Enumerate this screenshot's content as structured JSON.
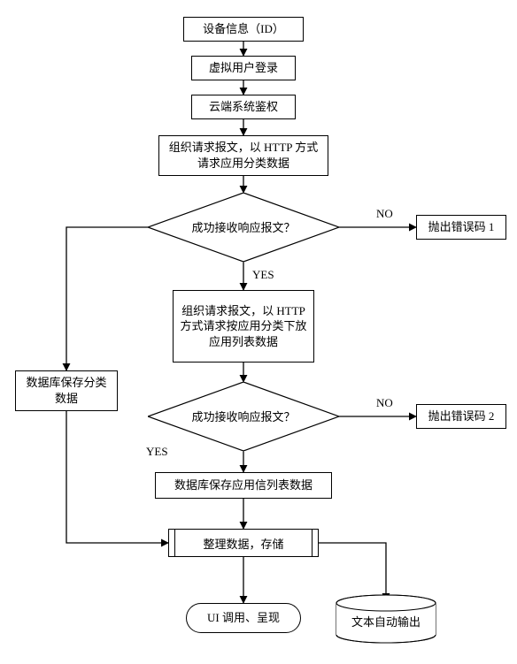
{
  "chart_data": {
    "type": "flowchart",
    "nodes": [
      {
        "id": "n1",
        "kind": "process",
        "label": "设备信息（ID）"
      },
      {
        "id": "n2",
        "kind": "process",
        "label": "虚拟用户登录"
      },
      {
        "id": "n3",
        "kind": "process",
        "label": "云端系统鉴权"
      },
      {
        "id": "n4",
        "kind": "process",
        "label": "组织请求报文，以 HTTP 方式请求应用分类数据"
      },
      {
        "id": "d1",
        "kind": "decision",
        "label": "成功接收响应报文？"
      },
      {
        "id": "e1",
        "kind": "process",
        "label": "抛出错误码 1"
      },
      {
        "id": "n5",
        "kind": "process",
        "label": "组织请求报文，以 HTTP 方式请求按应用分类下放应用列表数据"
      },
      {
        "id": "s1",
        "kind": "process",
        "label": "数据库保存分类数据"
      },
      {
        "id": "d2",
        "kind": "decision",
        "label": "成功接收响应报文？"
      },
      {
        "id": "e2",
        "kind": "process",
        "label": "抛出错误码 2"
      },
      {
        "id": "n6",
        "kind": "process",
        "label": "数据库保存应用信列表数据"
      },
      {
        "id": "n7",
        "kind": "subprocess",
        "label": "整理数据，存储"
      },
      {
        "id": "t1",
        "kind": "terminator",
        "label": "UI 调用、呈现"
      },
      {
        "id": "t2",
        "kind": "datastore",
        "label": "文本自动输出"
      }
    ],
    "edges": [
      {
        "from": "n1",
        "to": "n2"
      },
      {
        "from": "n2",
        "to": "n3"
      },
      {
        "from": "n3",
        "to": "n4"
      },
      {
        "from": "n4",
        "to": "d1"
      },
      {
        "from": "d1",
        "to": "e1",
        "label": "NO"
      },
      {
        "from": "d1",
        "to": "n5",
        "label": "YES"
      },
      {
        "from": "d1",
        "to": "s1",
        "label": "YES"
      },
      {
        "from": "n5",
        "to": "d2"
      },
      {
        "from": "d2",
        "to": "e2",
        "label": "NO"
      },
      {
        "from": "d2",
        "to": "n6",
        "label": "YES"
      },
      {
        "from": "n6",
        "to": "n7"
      },
      {
        "from": "s1",
        "to": "n7"
      },
      {
        "from": "n7",
        "to": "t1"
      },
      {
        "from": "n7",
        "to": "t2"
      }
    ],
    "branch_labels": {
      "yes": "YES",
      "no": "NO"
    }
  }
}
